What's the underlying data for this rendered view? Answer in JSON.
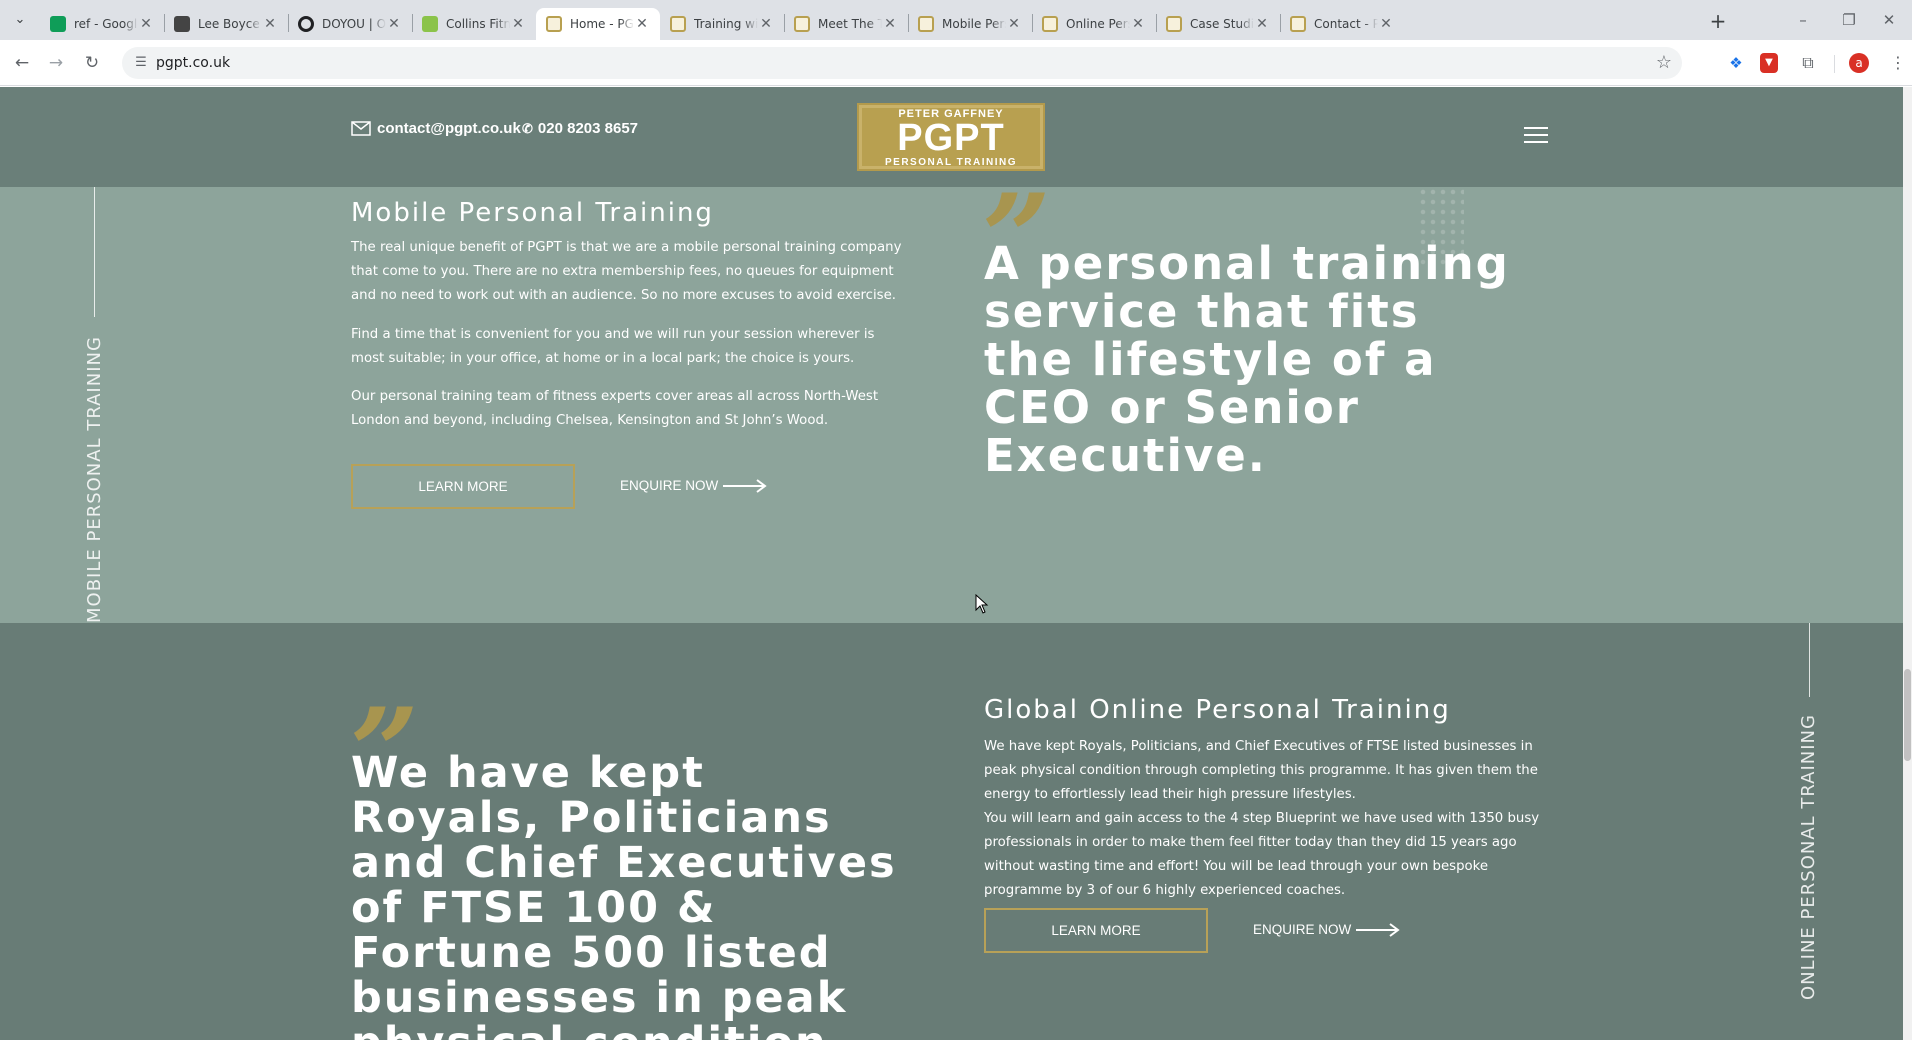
{
  "browser": {
    "tabs": [
      {
        "title": "ref - Google Sheets",
        "icon": "sheets-icon",
        "color": "#0f9d58",
        "active": false
      },
      {
        "title": "Lee Boyce | Real",
        "icon": "person-icon",
        "color": "#444444",
        "active": false
      },
      {
        "title": "DOYOU | Online",
        "icon": "circle-o-icon",
        "color": "#202124",
        "active": false
      },
      {
        "title": "Collins Fitness",
        "icon": "green-square-icon",
        "color": "#8bc34a",
        "active": false
      },
      {
        "title": "Home - PGPT",
        "icon": "pgpt-icon",
        "color": "#b8a050",
        "active": true
      },
      {
        "title": "Training with Peter",
        "icon": "pgpt-icon",
        "color": "#b8a050",
        "active": false
      },
      {
        "title": "Meet The Trainers",
        "icon": "pgpt-icon",
        "color": "#b8a050",
        "active": false
      },
      {
        "title": "Mobile Personal Training",
        "icon": "pgpt-icon",
        "color": "#b8a050",
        "active": false
      },
      {
        "title": "Online Personal Training",
        "icon": "pgpt-icon",
        "color": "#b8a050",
        "active": false
      },
      {
        "title": "Case Studies - PGPT",
        "icon": "pgpt-icon",
        "color": "#b8a050",
        "active": false
      },
      {
        "title": "Contact - PGPT",
        "icon": "pgpt-icon",
        "color": "#b8a050",
        "active": false
      }
    ],
    "url": "pgpt.co.uk",
    "profile_initial": "a"
  },
  "header": {
    "email": "contact@pgpt.co.uk",
    "phone": "020 8203 8657",
    "logo": {
      "line1": "PETER GAFFNEY",
      "line2": "PGPT",
      "line3": "PERSONAL TRAINING"
    }
  },
  "mobile": {
    "side_label": "MOBILE PERSONAL TRAINING",
    "title": "Mobile Personal Training",
    "paragraphs": [
      "The real unique benefit of PGPT is that we are a mobile personal training company that come to you. There are no extra membership fees, no queues for equipment and no need to work out with an audience. So no more excuses to avoid exercise.",
      "Find a time that is convenient for you and we will run your session wherever is most suitable; in your office, at home or in a local park; the choice is yours.",
      "Our personal training team of fitness experts cover areas all across North-West London and beyond, including Chelsea, Kensington and St John’s Wood."
    ],
    "learn_more": "LEARN MORE",
    "enquire": "ENQUIRE NOW",
    "quote_mark": "”",
    "quote": "A personal training service that fits the lifestyle of a CEO or Senior Executive."
  },
  "online": {
    "side_label": "ONLINE PERSONAL TRAINING",
    "title": "Global Online Personal Training",
    "paragraphs": [
      "We have kept Royals, Politicians, and Chief Executives of FTSE listed businesses in peak physical condition through completing this programme. It has given them the energy to effortlessly lead their high pressure lifestyles.",
      "You will learn and gain access to the 4 step Blueprint we have used with 1350 busy professionals in order to make them feel fitter today than they did 15 years ago without wasting time and effort! You will be lead through your own bespoke programme by 3 of our 6 highly experienced coaches."
    ],
    "learn_more": "LEARN MORE",
    "enquire": "ENQUIRE NOW",
    "quote_mark": "”",
    "quote": "We have kept Royals, Politicians and Chief Executives of FTSE 100 & Fortune 500 listed businesses in peak physical condition."
  },
  "colors": {
    "header_bg": "#6a7f79",
    "section1_bg": "#8da49b",
    "section2_bg": "#687c76",
    "gold": "#b7a158"
  }
}
